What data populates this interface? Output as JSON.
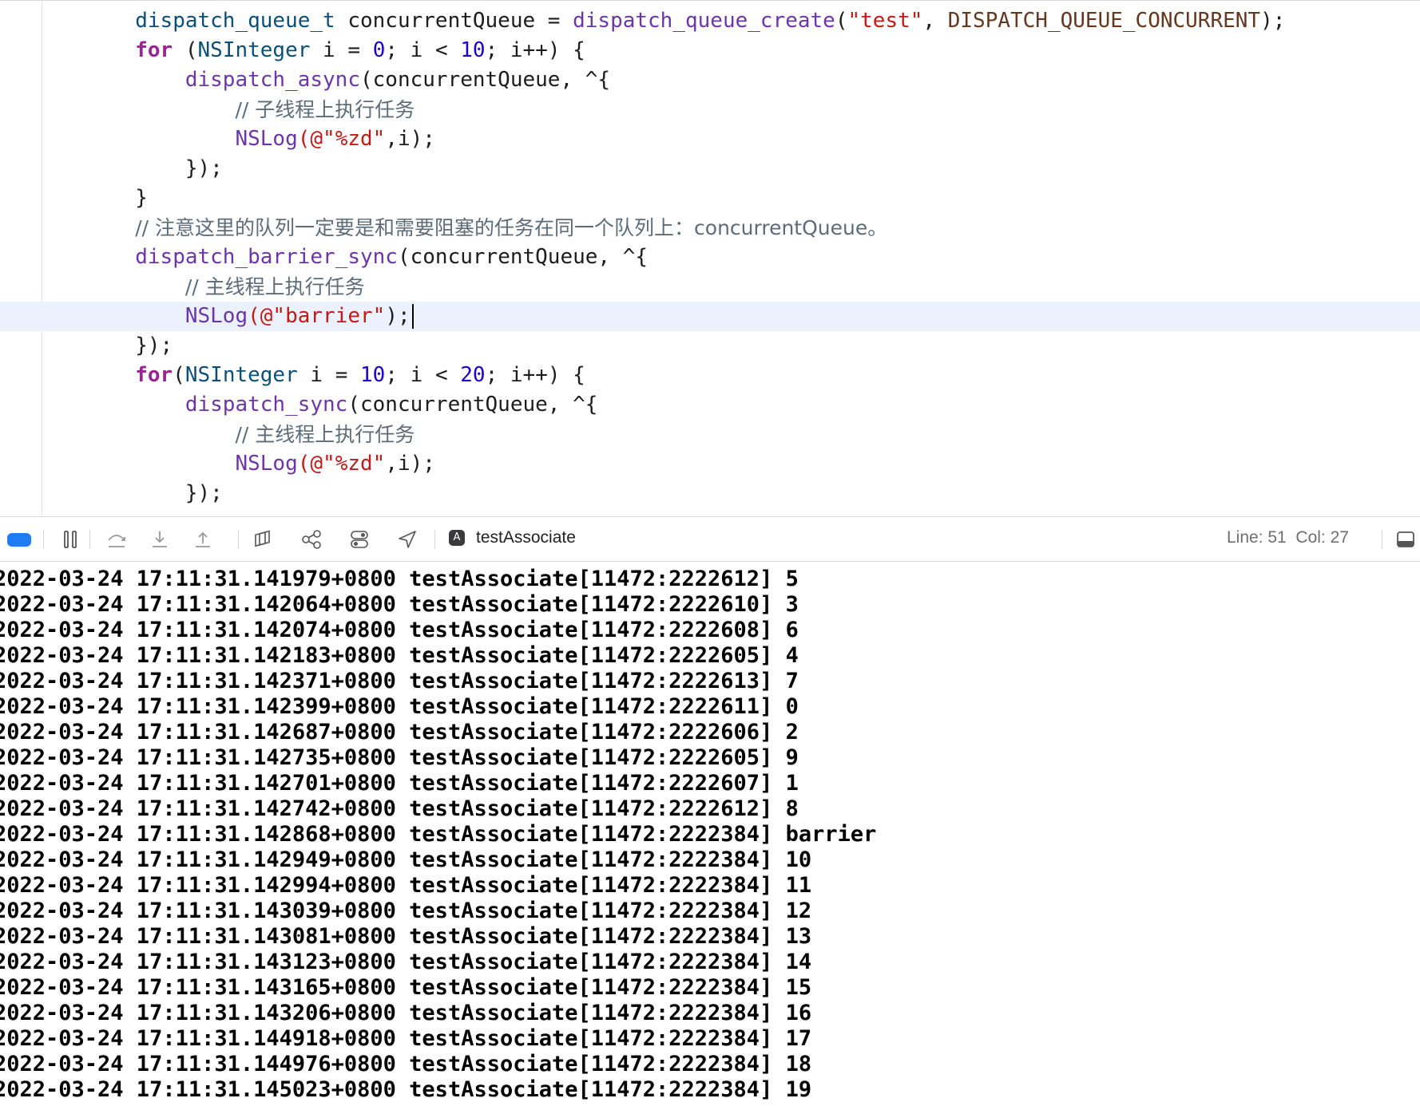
{
  "editor": {
    "lines": [
      {
        "segs": [
          [
            "",
            "        "
          ],
          [
            "t",
            "dispatch_queue_t"
          ],
          [
            "",
            " concurrentQueue = "
          ],
          [
            "f",
            "dispatch_queue_create"
          ],
          [
            "",
            "("
          ],
          [
            "s",
            "\"test\""
          ],
          [
            "",
            ", "
          ],
          [
            "m",
            "DISPATCH_QUEUE_CONCURRENT"
          ],
          [
            "",
            ");"
          ]
        ]
      },
      {
        "segs": [
          [
            "",
            "        "
          ],
          [
            "k",
            "for"
          ],
          [
            "",
            " ("
          ],
          [
            "t",
            "NSInteger"
          ],
          [
            "",
            " i = "
          ],
          [
            "n",
            "0"
          ],
          [
            "",
            "; i < "
          ],
          [
            "n",
            "10"
          ],
          [
            "",
            "; i++) {"
          ]
        ]
      },
      {
        "segs": [
          [
            "",
            "            "
          ],
          [
            "f",
            "dispatch_async"
          ],
          [
            "",
            "(concurrentQueue, ^{"
          ]
        ]
      },
      {
        "segs": [
          [
            "",
            "                "
          ],
          [
            "c",
            "// 子线程上执行任务"
          ]
        ]
      },
      {
        "segs": [
          [
            "",
            "                "
          ],
          [
            "f",
            "NSLog"
          ],
          [
            "s",
            "(@\"%zd\""
          ],
          [
            "",
            ",i);"
          ]
        ]
      },
      {
        "segs": [
          [
            "",
            "            "
          ],
          [
            "",
            "});"
          ]
        ]
      },
      {
        "segs": [
          [
            "",
            "        "
          ],
          [
            "",
            "}"
          ]
        ]
      },
      {
        "segs": [
          [
            "",
            "        "
          ],
          [
            "c",
            "// 注意这里的队列一定要是和需要阻塞的任务在同一个队列上：concurrentQueue。"
          ]
        ]
      },
      {
        "segs": [
          [
            "",
            "        "
          ],
          [
            "f",
            "dispatch_barrier_sync"
          ],
          [
            "",
            "(concurrentQueue, ^{"
          ]
        ]
      },
      {
        "segs": [
          [
            "",
            "            "
          ],
          [
            "c",
            "// 主线程上执行任务"
          ]
        ]
      },
      {
        "segs": [
          [
            "",
            "            "
          ],
          [
            "f",
            "NSLog"
          ],
          [
            "s",
            "(@\"barrier\""
          ],
          [
            "",
            ");"
          ]
        ],
        "current": true
      },
      {
        "segs": [
          [
            "",
            "        "
          ],
          [
            "",
            "});"
          ]
        ]
      },
      {
        "segs": [
          [
            "",
            "        "
          ],
          [
            "k",
            "for"
          ],
          [
            "",
            "("
          ],
          [
            "t",
            "NSInteger"
          ],
          [
            "",
            " i = "
          ],
          [
            "n",
            "10"
          ],
          [
            "",
            "; i < "
          ],
          [
            "n",
            "20"
          ],
          [
            "",
            "; i++) {"
          ]
        ]
      },
      {
        "segs": [
          [
            "",
            "            "
          ],
          [
            "f",
            "dispatch_sync"
          ],
          [
            "",
            "(concurrentQueue, ^{"
          ]
        ]
      },
      {
        "segs": [
          [
            "",
            "                "
          ],
          [
            "c",
            "// 主线程上执行任务"
          ]
        ]
      },
      {
        "segs": [
          [
            "",
            "                "
          ],
          [
            "f",
            "NSLog"
          ],
          [
            "s",
            "(@\"%zd\""
          ],
          [
            "",
            ",i);"
          ]
        ]
      },
      {
        "segs": [
          [
            "",
            "            "
          ],
          [
            "",
            "});"
          ]
        ]
      }
    ]
  },
  "debugbar": {
    "process_name": "testAssociate",
    "cursor_position": "Line: 51  Col: 27",
    "icons": [
      "breakpoint-toggle-icon",
      "pause-icon",
      "step-over-icon",
      "step-into-icon",
      "step-out-icon",
      "view-hierarchy-icon",
      "memory-graph-icon",
      "environment-overrides-icon",
      "simulate-location-icon",
      "app-icon",
      "panel-toggle-icon"
    ]
  },
  "console": {
    "lines": [
      "2022-03-24 17:11:31.141979+0800 testAssociate[11472:2222612] 5",
      "2022-03-24 17:11:31.142064+0800 testAssociate[11472:2222610] 3",
      "2022-03-24 17:11:31.142074+0800 testAssociate[11472:2222608] 6",
      "2022-03-24 17:11:31.142183+0800 testAssociate[11472:2222605] 4",
      "2022-03-24 17:11:31.142371+0800 testAssociate[11472:2222613] 7",
      "2022-03-24 17:11:31.142399+0800 testAssociate[11472:2222611] 0",
      "2022-03-24 17:11:31.142687+0800 testAssociate[11472:2222606] 2",
      "2022-03-24 17:11:31.142735+0800 testAssociate[11472:2222605] 9",
      "2022-03-24 17:11:31.142701+0800 testAssociate[11472:2222607] 1",
      "2022-03-24 17:11:31.142742+0800 testAssociate[11472:2222612] 8",
      "2022-03-24 17:11:31.142868+0800 testAssociate[11472:2222384] barrier",
      "2022-03-24 17:11:31.142949+0800 testAssociate[11472:2222384] 10",
      "2022-03-24 17:11:31.142994+0800 testAssociate[11472:2222384] 11",
      "2022-03-24 17:11:31.143039+0800 testAssociate[11472:2222384] 12",
      "2022-03-24 17:11:31.143081+0800 testAssociate[11472:2222384] 13",
      "2022-03-24 17:11:31.143123+0800 testAssociate[11472:2222384] 14",
      "2022-03-24 17:11:31.143165+0800 testAssociate[11472:2222384] 15",
      "2022-03-24 17:11:31.143206+0800 testAssociate[11472:2222384] 16",
      "2022-03-24 17:11:31.144918+0800 testAssociate[11472:2222384] 17",
      "2022-03-24 17:11:31.144976+0800 testAssociate[11472:2222384] 18",
      "2022-03-24 17:11:31.145023+0800 testAssociate[11472:2222384] 19"
    ]
  },
  "colors": {
    "keyword": "#9b2393",
    "type": "#0b4f79",
    "function": "#6c36a9",
    "string": "#c41a16",
    "number": "#1c00cf",
    "macro": "#643820",
    "comment": "#5d6c79",
    "current_line": "#ebf2fd",
    "accent": "#1f7cf5"
  }
}
